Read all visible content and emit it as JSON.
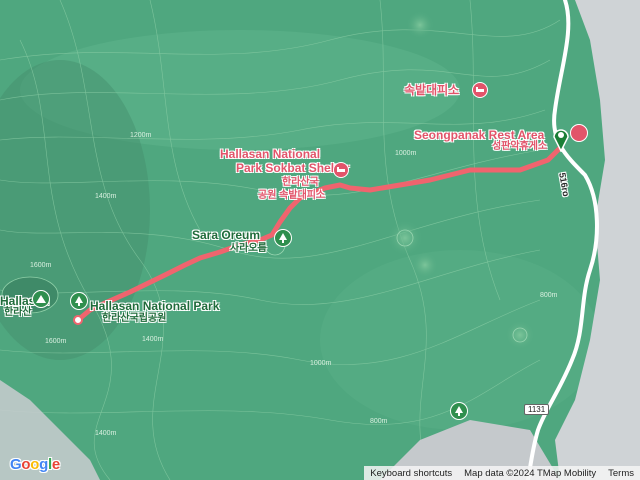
{
  "map": {
    "provider_logo": [
      "G",
      "o",
      "o",
      "g",
      "l",
      "e"
    ],
    "logo_colors": [
      "#4285f4",
      "#ea4335",
      "#fbbc05",
      "#4285f4",
      "#34a853",
      "#ea4335"
    ],
    "footer": {
      "keyboard": "Keyboard shortcuts",
      "attribution": "Map data ©2024 TMap Mobility",
      "terms": "Terms"
    },
    "colors": {
      "terrain": "#4fa77f",
      "route": "#f0646e",
      "marker": "#1a7f36",
      "poi_red": "#e2546a",
      "poi_green": "#1f6b3a"
    },
    "labels": {
      "sokbat_ko": "속밭대피소",
      "rest_area_en": "Seongpanak Rest Area",
      "rest_area_ko": "성판악휴게소",
      "shelter_en_1": "Hallasan National",
      "shelter_en_2": "Park Sokbat Shelter",
      "shelter_ko_1": "한라산국",
      "shelter_ko_2": "공원 속밭대피소",
      "sara_en": "Sara Oreum",
      "sara_ko": "사라오름",
      "park_en": "Hallasan National Park",
      "park_ko": "한라산국립공원",
      "summit_en": "Hallasan",
      "summit_ko": "한라산"
    },
    "contours": [
      "1200m",
      "1400m",
      "1000m",
      "1400m",
      "1600m",
      "1600m",
      "800m",
      "1400m",
      "1000m",
      "800m"
    ],
    "road": {
      "name": "516ro",
      "shield": "1131"
    }
  }
}
